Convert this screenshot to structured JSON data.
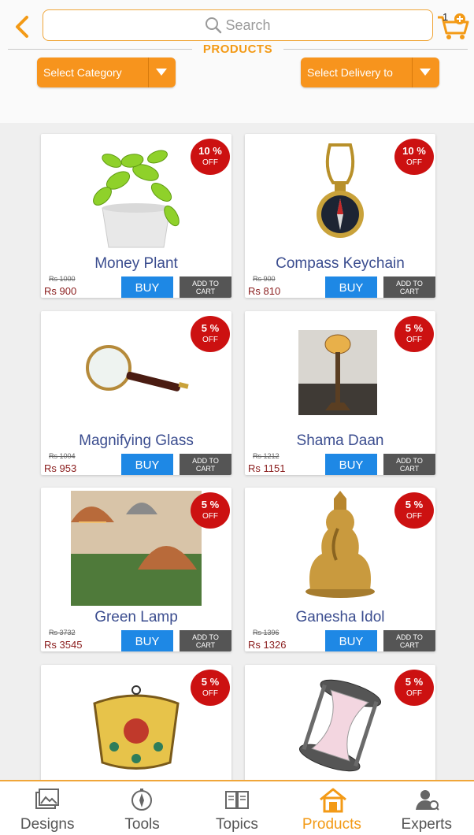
{
  "header": {
    "search_placeholder": "Search",
    "cart_count": "1",
    "section_title": "PRODUCTS",
    "category_dropdown": "Select Category",
    "delivery_dropdown": "Select Delivery to"
  },
  "products": [
    {
      "name": "Money Plant",
      "discount": "10 %",
      "off": "OFF",
      "old_price": "Rs 1000",
      "price": "Rs 900",
      "buy": "BUY",
      "add_to_cart": "ADD TO CART",
      "icon": "plant-image"
    },
    {
      "name": "Compass Keychain",
      "discount": "10 %",
      "off": "OFF",
      "old_price": "Rs 900",
      "price": "Rs 810",
      "buy": "BUY",
      "add_to_cart": "ADD TO CART",
      "icon": "compass-image"
    },
    {
      "name": "Magnifying Glass",
      "discount": "5 %",
      "off": "OFF",
      "old_price": "Rs 1004",
      "price": "Rs 953",
      "buy": "BUY",
      "add_to_cart": "ADD TO CART",
      "icon": "magnifier-image"
    },
    {
      "name": "Shama Daan",
      "discount": "5 %",
      "off": "OFF",
      "old_price": "Rs 1212",
      "price": "Rs 1151",
      "buy": "BUY",
      "add_to_cart": "ADD TO CART",
      "icon": "candle-stand-image"
    },
    {
      "name": "Green Lamp",
      "discount": "5 %",
      "off": "OFF",
      "old_price": "Rs 3732",
      "price": "Rs 3545",
      "buy": "BUY",
      "add_to_cart": "ADD TO CART",
      "icon": "lamp-image"
    },
    {
      "name": "Ganesha Idol",
      "discount": "5 %",
      "off": "OFF",
      "old_price": "Rs 1396",
      "price": "Rs 1326",
      "buy": "BUY",
      "add_to_cart": "ADD TO CART",
      "icon": "idol-image"
    },
    {
      "name": "",
      "discount": "5 %",
      "off": "OFF",
      "old_price": "",
      "price": "",
      "buy": "",
      "add_to_cart": "",
      "icon": "wall-hanging-image"
    },
    {
      "name": "",
      "discount": "5 %",
      "off": "OFF",
      "old_price": "",
      "price": "",
      "buy": "",
      "add_to_cart": "",
      "icon": "hourglass-image"
    }
  ],
  "nav": [
    {
      "label": "Designs",
      "icon": "designs-icon"
    },
    {
      "label": "Tools",
      "icon": "compass-icon"
    },
    {
      "label": "Topics",
      "icon": "book-icon"
    },
    {
      "label": "Products",
      "icon": "house-icon"
    },
    {
      "label": "Experts",
      "icon": "expert-icon"
    }
  ],
  "colors": {
    "accent": "#f7941d",
    "badge": "#cc1111",
    "buy": "#1e88e5",
    "add_to_cart": "#555555",
    "product_name": "#3b4d8f"
  }
}
